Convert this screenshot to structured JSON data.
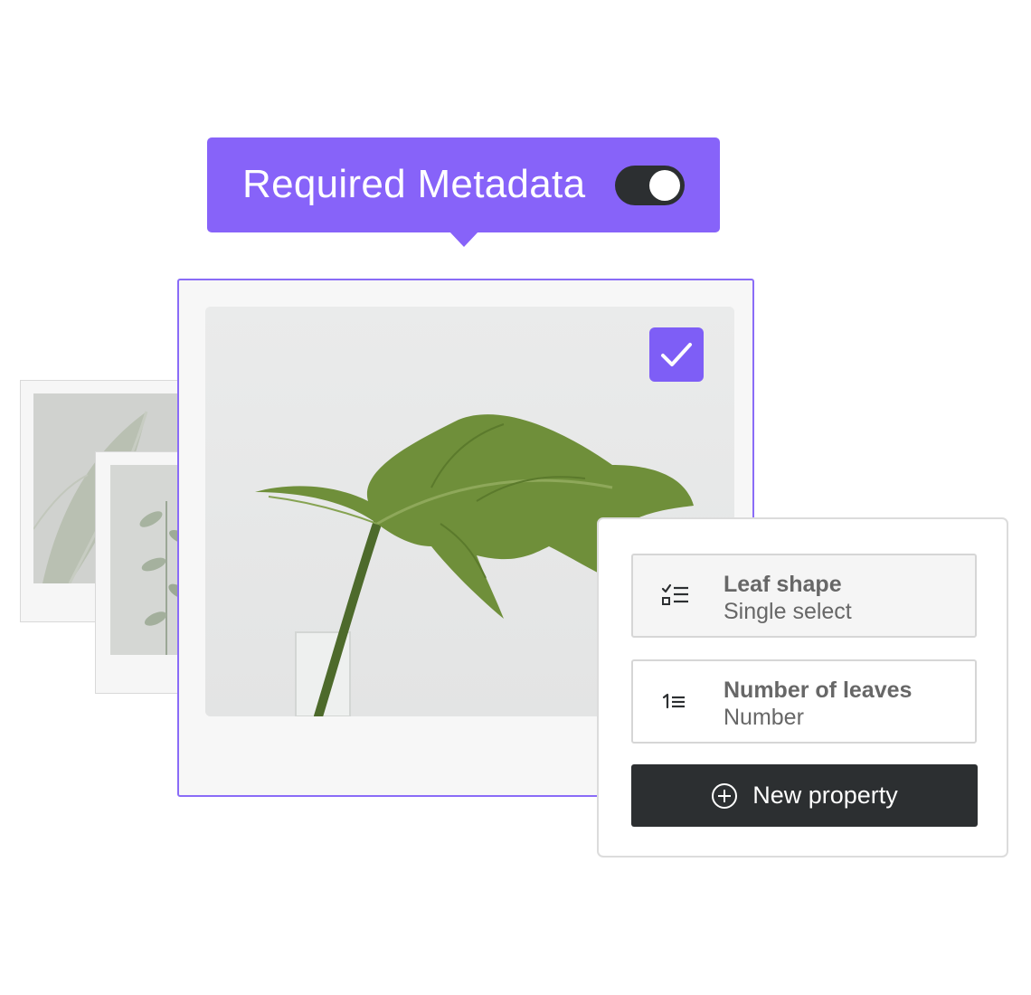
{
  "banner": {
    "title": "Required Metadata",
    "toggle_on": true
  },
  "colors": {
    "accent": "#8763f9",
    "accent_checkbox": "#7e5ef6",
    "dark": "#2c2f31",
    "card_border": "#8a6cf7"
  },
  "main_card": {
    "selected": true,
    "image_icon": "monstera-leaf-photo"
  },
  "properties": [
    {
      "title": "Leaf shape",
      "type": "Single select",
      "icon": "checklist-icon"
    },
    {
      "title": "Number of leaves",
      "type": "Number",
      "icon": "numbered-list-icon"
    }
  ],
  "new_property_button": {
    "label": "New property",
    "icon": "plus-circle-icon"
  }
}
